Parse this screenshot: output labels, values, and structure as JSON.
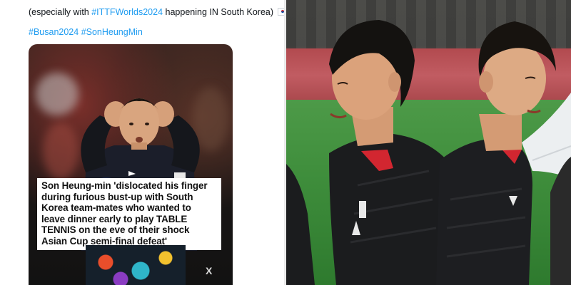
{
  "tweet": {
    "text_prefix": "(especially with ",
    "hashtag_itf": "#ITTFWorlds2024",
    "text_suffix": " happening IN South Korea) ",
    "hashtag_busan": "#Busan2024",
    "hashtag_son": "#SonHeungMin"
  },
  "media_card": {
    "headline": "Son Heung-min 'dislocated his finger during furious bust-up with South Korea team-mates who wanted to leave dinner early to play TABLE TENNIS on the eve of their shock Asian Cup semi-final defeat'",
    "watermark": "X"
  },
  "icons": {
    "flag": "south-korea-flag-icon",
    "emoji": "grin-sweat-emoji-icon"
  },
  "colors": {
    "hashtag": "#1d9bf0",
    "text": "#0f1419",
    "jersey_red_collar": "#d22630",
    "jersey_black": "#1b1c1e"
  }
}
